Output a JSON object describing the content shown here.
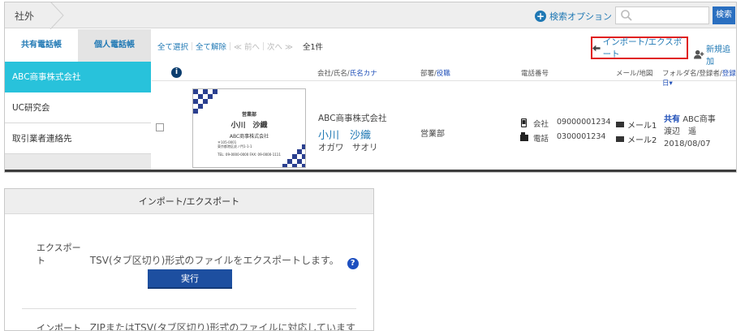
{
  "topbar": {
    "breadcrumb": "社外",
    "search_option": "検索オプション",
    "search_placeholder": "",
    "search_button": "検索"
  },
  "tabs": [
    {
      "label": "共有電話帳",
      "active": true
    },
    {
      "label": "個人電話帳",
      "active": false
    }
  ],
  "sidebar": {
    "items": [
      {
        "label": "ABC商事株式会社",
        "active": true
      },
      {
        "label": "UC研究会",
        "active": false
      },
      {
        "label": "取引業者連絡先",
        "active": false
      }
    ]
  },
  "toolbar": {
    "select_all": "全て選択",
    "deselect_all": "全て解除",
    "prev": "≪ 前へ",
    "next": "次へ ≫",
    "count": "全1件",
    "import_export": "インポート/エクスポート",
    "add_new": "新規追加"
  },
  "table": {
    "headers": {
      "company": "会社/氏名/",
      "kana": "氏名カナ",
      "dept": "部署/",
      "title": "役職",
      "phone": "電話番号",
      "mail": "メール/地図",
      "folder": "フォルダ名/登録者/",
      "registered": "登録日▾"
    },
    "rows": [
      {
        "card": {
          "company": "営業部",
          "name": "小川　沙織",
          "company_line": "ABC商事株式会社",
          "address": "〒105-0001",
          "address2": "東京都港区虎ノ門1-1-1",
          "tel": "TEL: 09-0000-0000  FAX: 09-0000-1111"
        },
        "company": "ABC商事株式会社",
        "name": "小川　沙織",
        "kana": "オガワ　サオリ",
        "dept": "営業部",
        "phones": [
          {
            "type": "会社",
            "number": "09000001234"
          },
          {
            "type": "電話",
            "number": "0300001234"
          }
        ],
        "mails": [
          "メール1",
          "メール2"
        ],
        "folder_tag": "共有",
        "folder": "ABC商事",
        "registrant": "渡辺　遥",
        "date": "2018/08/07"
      }
    ]
  },
  "dialog": {
    "title": "インポート/エクスポート",
    "export_label": "エクスポート",
    "export_desc": "TSV(タブ区切り)形式のファイルをエクスポートします。",
    "execute": "実行",
    "import_label": "インポート",
    "import_desc": "ZIPまたはTSV(タブ区切り)形式のファイルに対応しています"
  },
  "colors": {
    "accent": "#1f78b4",
    "active_sidebar": "#28c2db",
    "highlight_border": "#e02020",
    "button": "#1d4fa0"
  }
}
